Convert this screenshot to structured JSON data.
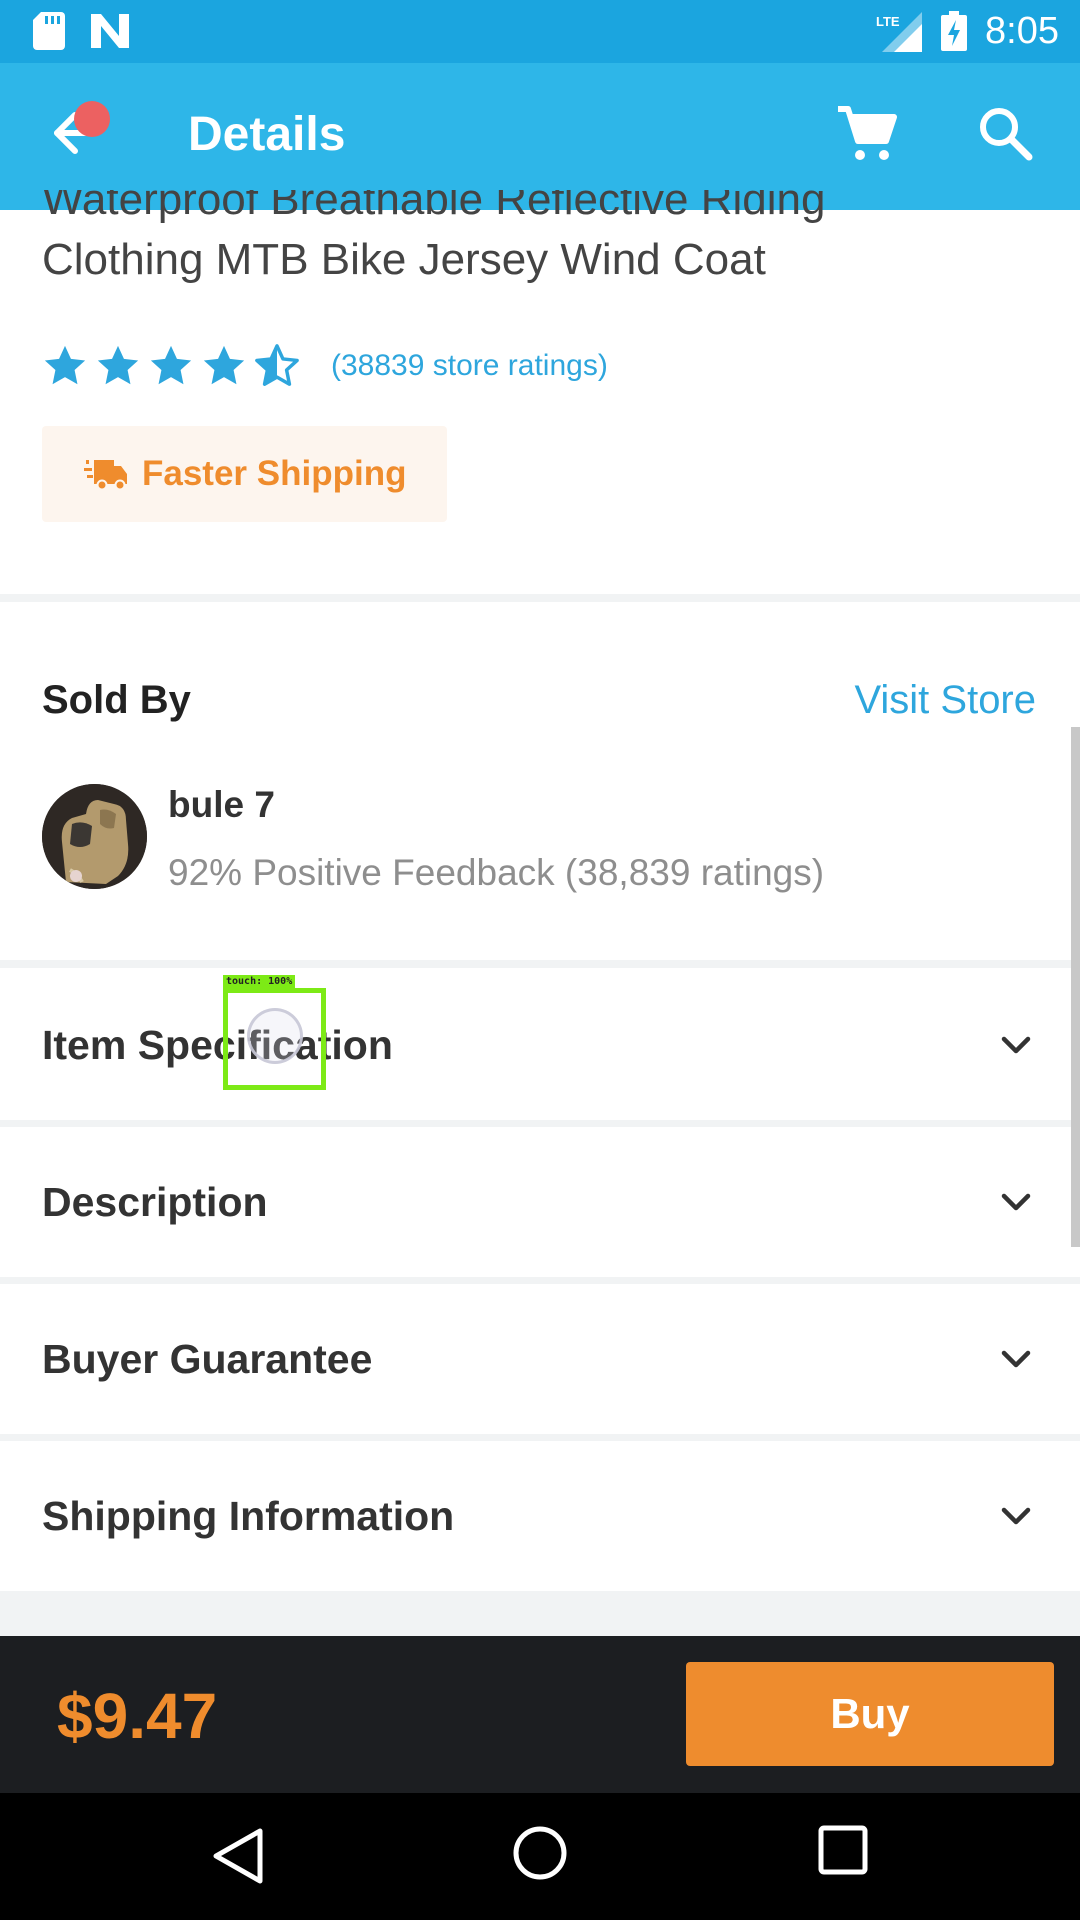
{
  "status_bar": {
    "time": "8:05",
    "network_label": "LTE"
  },
  "app_bar": {
    "title": "Details",
    "icons": [
      "back-arrow-icon",
      "cart-icon",
      "search-icon"
    ],
    "notification_dot_color": "#ec6161"
  },
  "product": {
    "title_line_1": "Waterproof Breathable Reflective Riding",
    "title_line_2": "Clothing MTB Bike Jersey Wind Coat",
    "rating_stars": 4.5,
    "rating_count_text": "(38839 store ratings)",
    "shipping_badge": "Faster Shipping"
  },
  "seller": {
    "section_title": "Sold By",
    "visit_store_label": "Visit Store",
    "name": "bule 7",
    "feedback": "92% Positive Feedback (38,839 ratings)"
  },
  "sections": [
    {
      "label": "Item Specification"
    },
    {
      "label": "Description"
    },
    {
      "label": "Buyer Guarantee"
    },
    {
      "label": "Shipping Information"
    }
  ],
  "touch_overlay": {
    "label": "touch: 100%"
  },
  "buy_bar": {
    "price": "$9.47",
    "buy_label": "Buy"
  },
  "colors": {
    "status_bar": "#1ba5df",
    "app_bar": "#2eb6e8",
    "accent_blue": "#2ea6dd",
    "accent_orange": "#ef8c2d",
    "buy_bar": "#1c1e21"
  }
}
